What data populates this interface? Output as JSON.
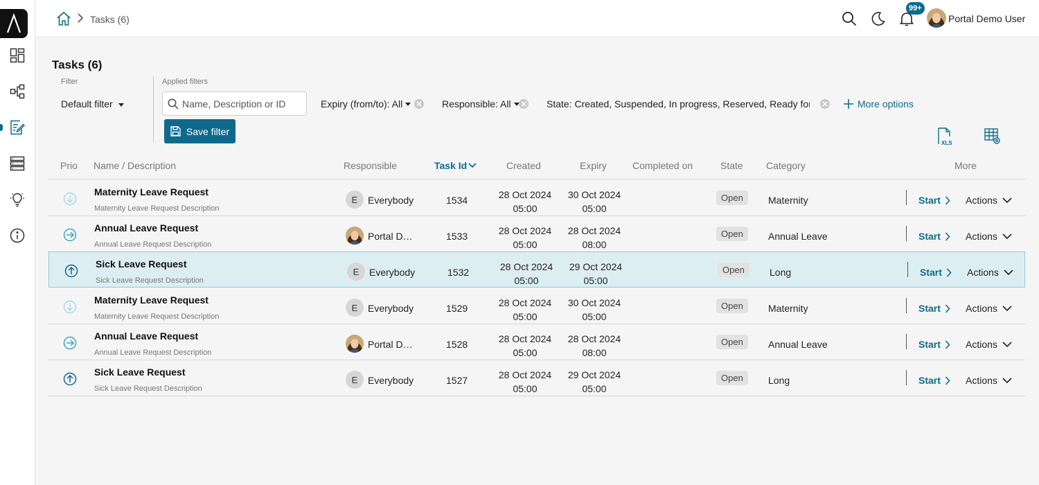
{
  "breadcrumb": {
    "current": "Tasks (6)"
  },
  "header": {
    "notification_count": "99+",
    "user_name": "Portal Demo User"
  },
  "page": {
    "title": "Tasks (6)"
  },
  "filters": {
    "filter_label": "Filter",
    "default_filter": "Default filter",
    "applied_label": "Applied filters",
    "search_placeholder": "Name, Description or ID",
    "expiry": "Expiry (from/to): All",
    "responsible": "Responsible: All",
    "state": "State: Created, Suspended, In progress, Reserved, Ready for jo",
    "more_options": "More options",
    "save_filter": "Save filter"
  },
  "table": {
    "columns": {
      "prio": "Prio",
      "name": "Name / Description",
      "responsible": "Responsible",
      "task_id": "Task Id",
      "created": "Created",
      "expiry": "Expiry",
      "completed": "Completed on",
      "state": "State",
      "category": "Category",
      "more": "More"
    },
    "start_label": "Start",
    "actions_label": "Actions",
    "rows": [
      {
        "prio": "low",
        "name": "Maternity Leave Request",
        "desc": "Maternity Leave Request Description",
        "resp_initial": "E",
        "resp_photo": false,
        "responsible": "Everybody",
        "task_id": "1534",
        "created_date": "28 Oct 2024",
        "created_time": "05:00",
        "expiry_date": "30 Oct 2024",
        "expiry_time": "05:00",
        "completed": "",
        "state": "Open",
        "category": "Maternity"
      },
      {
        "prio": "normal",
        "name": "Annual Leave Request",
        "desc": "Annual Leave Request Description",
        "resp_initial": "",
        "resp_photo": true,
        "responsible": "Portal Demo User",
        "task_id": "1533",
        "created_date": "28 Oct 2024",
        "created_time": "05:00",
        "expiry_date": "28 Oct 2024",
        "expiry_time": "08:00",
        "completed": "",
        "state": "Open",
        "category": "Annual Leave"
      },
      {
        "prio": "high",
        "name": "Sick Leave Request",
        "desc": "Sick Leave Request Description",
        "resp_initial": "E",
        "resp_photo": false,
        "responsible": "Everybody",
        "task_id": "1532",
        "created_date": "28 Oct 2024",
        "created_time": "05:00",
        "expiry_date": "29 Oct 2024",
        "expiry_time": "05:00",
        "completed": "",
        "state": "Open",
        "category": "Long",
        "selected": true
      },
      {
        "prio": "low",
        "name": "Maternity Leave Request",
        "desc": "Maternity Leave Request Description",
        "resp_initial": "E",
        "resp_photo": false,
        "responsible": "Everybody",
        "task_id": "1529",
        "created_date": "28 Oct 2024",
        "created_time": "05:00",
        "expiry_date": "30 Oct 2024",
        "expiry_time": "05:00",
        "completed": "",
        "state": "Open",
        "category": "Maternity"
      },
      {
        "prio": "normal",
        "name": "Annual Leave Request",
        "desc": "Annual Leave Request Description",
        "resp_initial": "",
        "resp_photo": true,
        "responsible": "Portal Demo User",
        "task_id": "1528",
        "created_date": "28 Oct 2024",
        "created_time": "05:00",
        "expiry_date": "28 Oct 2024",
        "expiry_time": "08:00",
        "completed": "",
        "state": "Open",
        "category": "Annual Leave"
      },
      {
        "prio": "high",
        "name": "Sick Leave Request",
        "desc": "Sick Leave Request Description",
        "resp_initial": "E",
        "resp_photo": false,
        "responsible": "Everybody",
        "task_id": "1527",
        "created_date": "28 Oct 2024",
        "created_time": "05:00",
        "expiry_date": "29 Oct 2024",
        "expiry_time": "05:00",
        "completed": "",
        "state": "Open",
        "category": "Long"
      }
    ]
  },
  "colors": {
    "accent": "#0e6a8c",
    "prio_low": "#a8dbe8",
    "prio_normal": "#3aa7c7",
    "prio_high": "#0e6a8c",
    "selected_row": "#ddeef3"
  },
  "icons": {
    "sidebar": [
      "app-logo-icon",
      "dashboard-icon",
      "processes-icon",
      "tasks-icon",
      "cases-icon",
      "ideas-icon",
      "info-icon"
    ],
    "header": [
      "home-icon",
      "search-icon",
      "dark-mode-icon",
      "bell-icon"
    ],
    "tools": [
      "export-xls-icon",
      "table-settings-icon"
    ]
  }
}
